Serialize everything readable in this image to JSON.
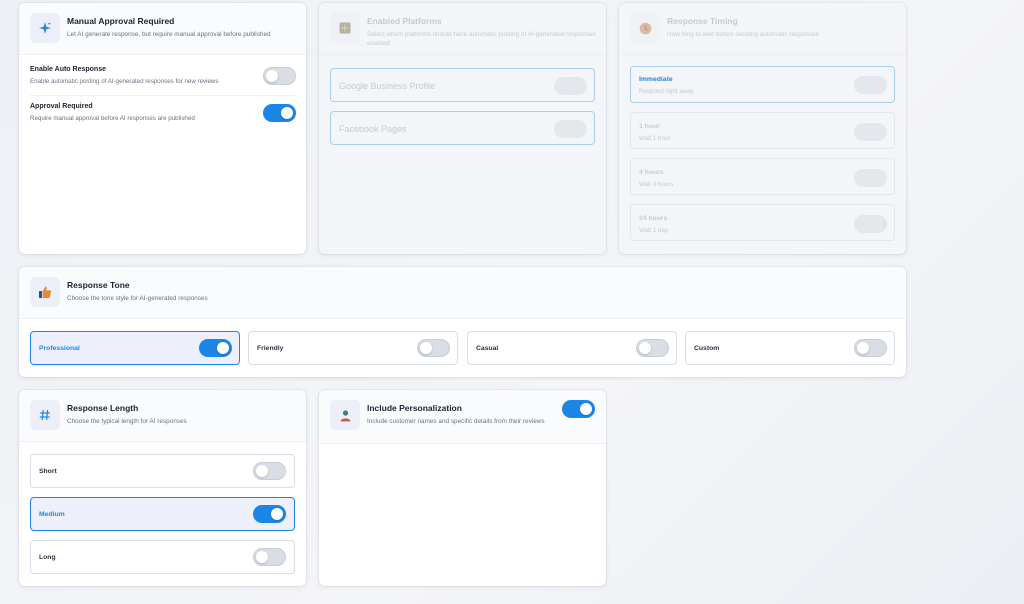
{
  "manual_approval": {
    "title": "Manual Approval Required",
    "description": "Let AI generate response, but require manual approval before published",
    "rows": [
      {
        "title": "Enable Auto Response",
        "description": "Enable automatic posting of AI-generated responses for new reviews",
        "enabled": false
      },
      {
        "title": "Approval Required",
        "description": "Require manual approval before AI responses are published",
        "enabled": true
      }
    ]
  },
  "enabled_platforms": {
    "title": "Enabled Platforms",
    "description": "Select which platforms should have automatic posting of AI-generated responses enabled",
    "platforms": [
      {
        "label": "Google Business Profile",
        "selected": true
      },
      {
        "label": "Facebook Pages",
        "selected": true
      }
    ]
  },
  "response_timing": {
    "title": "Response Timing",
    "description": "How long to wait before sending automatic responses",
    "options": [
      {
        "title": "Immediate",
        "subtitle": "Respond right away",
        "selected": true
      },
      {
        "title": "1 hour",
        "subtitle": "Wait 1 hour",
        "selected": false
      },
      {
        "title": "4 hours",
        "subtitle": "Wait 4 hours",
        "selected": false
      },
      {
        "title": "24 hours",
        "subtitle": "Wait 1 day",
        "selected": false
      }
    ]
  },
  "response_tone": {
    "title": "Response Tone",
    "description": "Choose the tone style for AI-generated responses",
    "options": [
      {
        "label": "Professional",
        "selected": true
      },
      {
        "label": "Friendly",
        "selected": false
      },
      {
        "label": "Casual",
        "selected": false
      },
      {
        "label": "Custom",
        "selected": false
      }
    ]
  },
  "response_length": {
    "title": "Response Length",
    "description": "Choose the typical length for AI responses",
    "options": [
      {
        "label": "Short",
        "selected": false
      },
      {
        "label": "Medium",
        "selected": true
      },
      {
        "label": "Long",
        "selected": false
      }
    ]
  },
  "personalization": {
    "title": "Include Personalization",
    "description": "Include customer names and specific details from their reviews",
    "enabled": true
  },
  "colors": {
    "accent": "#1c86e6",
    "selected_bg": "#edf0fb",
    "disabled_bg": "#f4f5f8"
  },
  "icons": {
    "manual_approval": "sparkle-icon",
    "enabled_platforms": "grid-icon",
    "response_timing": "clock-icon",
    "response_tone": "thumbs-up-icon",
    "response_length": "hash-icon",
    "personalization": "user-icon"
  }
}
